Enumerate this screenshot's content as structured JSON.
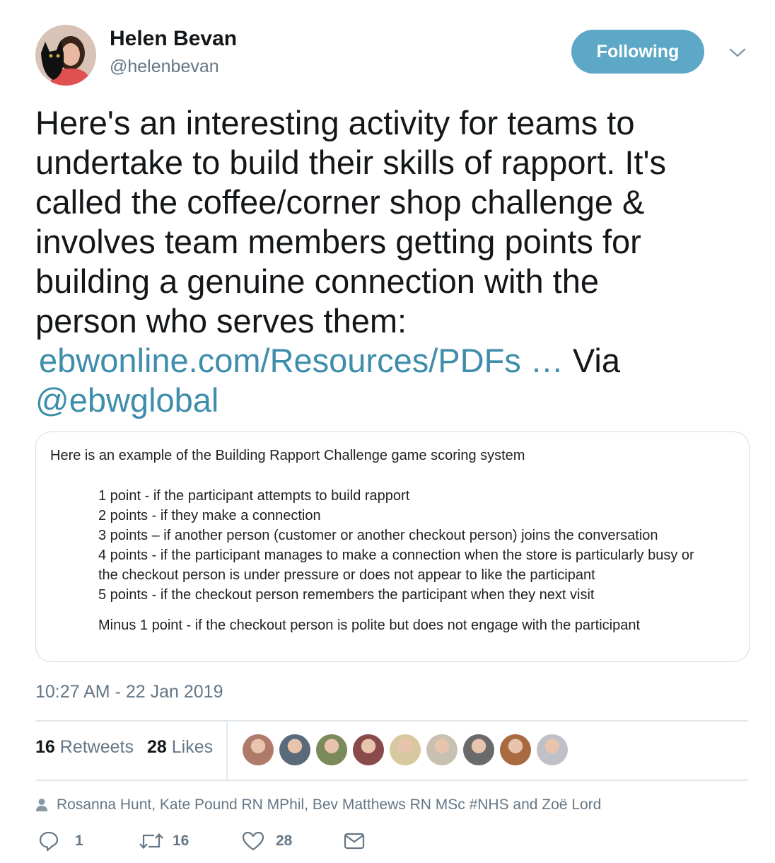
{
  "author": {
    "name": "Helen Bevan",
    "handle": "@helenbevan",
    "avatar_icon": "profile-photo"
  },
  "follow_button": {
    "label": "Following",
    "color": "#5da8c6"
  },
  "tweet": {
    "lines": [
      "Here's an interesting activity for teams to",
      "undertake to build their skills of rapport. It's",
      "called the coffee/corner shop challenge &",
      "involves team members getting points for",
      "building a genuine connection with the",
      "person who serves them:"
    ],
    "link_text": "ebwonline.com/Resources/PDFs",
    "ellipsis": " …",
    "via": " Via",
    "mention": "@ebwglobal",
    "link_color": "#3e8eab"
  },
  "card": {
    "title": "Here is an example of the Building Rapport Challenge game scoring system",
    "lines": [
      "1 point - if the participant attempts to build rapport",
      "2 points - if they make a connection",
      "3 points – if another person (customer or another checkout person) joins the conversation",
      "4 points - if the participant manages to make a connection when the store is particularly busy or",
      "the checkout person is under pressure or does not appear to like the participant",
      "5 points - if the checkout person remembers the participant when they next visit"
    ],
    "minus": "Minus 1 point - if the checkout person is polite but does not engage with the participant"
  },
  "timestamp": "10:27 AM - 22 Jan 2019",
  "stats": {
    "retweets_count": "16",
    "retweets_label": "Retweets",
    "likes_count": "28",
    "likes_label": "Likes"
  },
  "liked_by_faces": [
    "#b07a6a",
    "#5a6a7a",
    "#7a8a5a",
    "#8a4a4a",
    "#d8c8a0",
    "#c8c0b0",
    "#6a6a6a",
    "#a86a40",
    "#c0c0c8"
  ],
  "liked_by_text": "Rosanna Hunt, Kate Pound RN MPhil, Bev Matthews RN MSc #NHS and Zoë Lord",
  "actions": {
    "reply_count": "1",
    "retweet_count": "16",
    "like_count": "28"
  }
}
